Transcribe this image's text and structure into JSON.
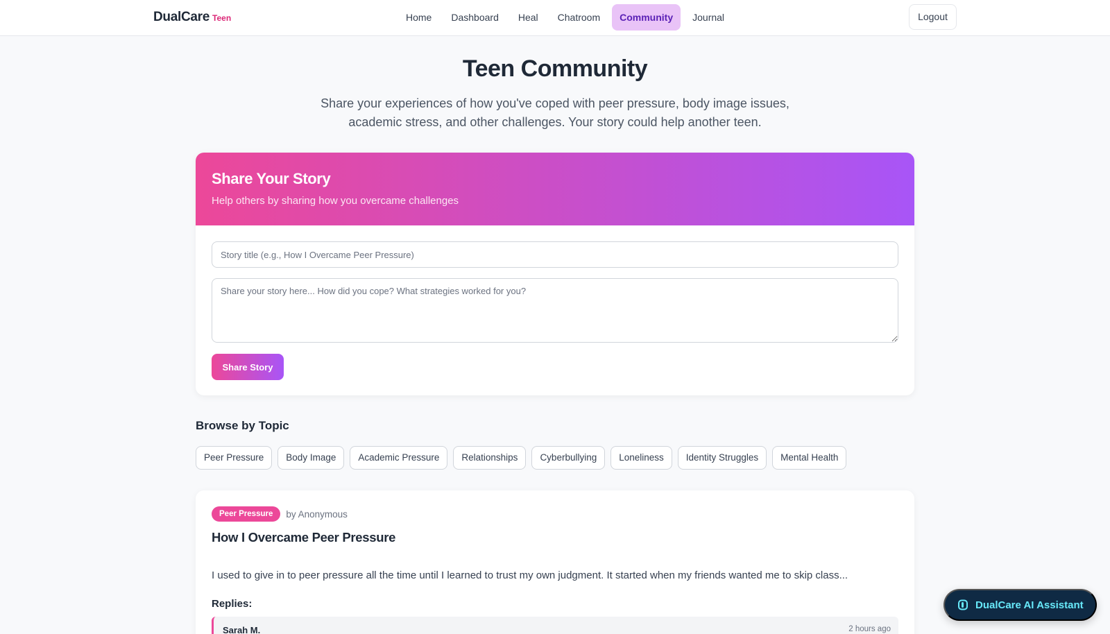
{
  "brand": {
    "name": "DualCare",
    "tag": "Teen"
  },
  "nav": {
    "items": [
      {
        "label": "Home",
        "active": false
      },
      {
        "label": "Dashboard",
        "active": false
      },
      {
        "label": "Heal",
        "active": false
      },
      {
        "label": "Chatroom",
        "active": false
      },
      {
        "label": "Community",
        "active": true
      },
      {
        "label": "Journal",
        "active": false
      }
    ],
    "logout_label": "Logout"
  },
  "hero": {
    "title": "Teen Community",
    "subtitle": "Share your experiences of how you've coped with peer pressure, body image issues, academic stress, and other challenges. Your story could help another teen."
  },
  "share_story": {
    "title": "Share Your Story",
    "subtitle": "Help others by sharing how you overcame challenges",
    "title_value": "",
    "title_placeholder": "Story title (e.g., How I Overcame Peer Pressure)",
    "body_value": "",
    "body_placeholder": "Share your story here... How did you cope? What strategies worked for you?",
    "button_label": "Share Story"
  },
  "browse": {
    "title": "Browse by Topic",
    "topics": [
      "Peer Pressure",
      "Body Image",
      "Academic Pressure",
      "Relationships",
      "Cyberbullying",
      "Loneliness",
      "Identity Struggles",
      "Mental Health"
    ]
  },
  "posts": [
    {
      "tag": "Peer Pressure",
      "author": "by Anonymous",
      "title": "How I Overcame Peer Pressure",
      "body": "I used to give in to peer pressure all the time until I learned to trust my own judgment. It started when my friends wanted me to skip class...",
      "replies_label": "Replies:",
      "replies": [
        {
          "author": "Sarah M.",
          "time": "2 hours ago"
        }
      ]
    }
  ],
  "assistant": {
    "label": "DualCare AI Assistant",
    "icon": "chat-bubble-icon"
  },
  "colors": {
    "accent_pink": "#ec4899",
    "accent_purple": "#a855f7",
    "nav_active_bg": "#e9c3f7",
    "assistant_bg": "#0f2a44",
    "assistant_text": "#67e8f9"
  }
}
